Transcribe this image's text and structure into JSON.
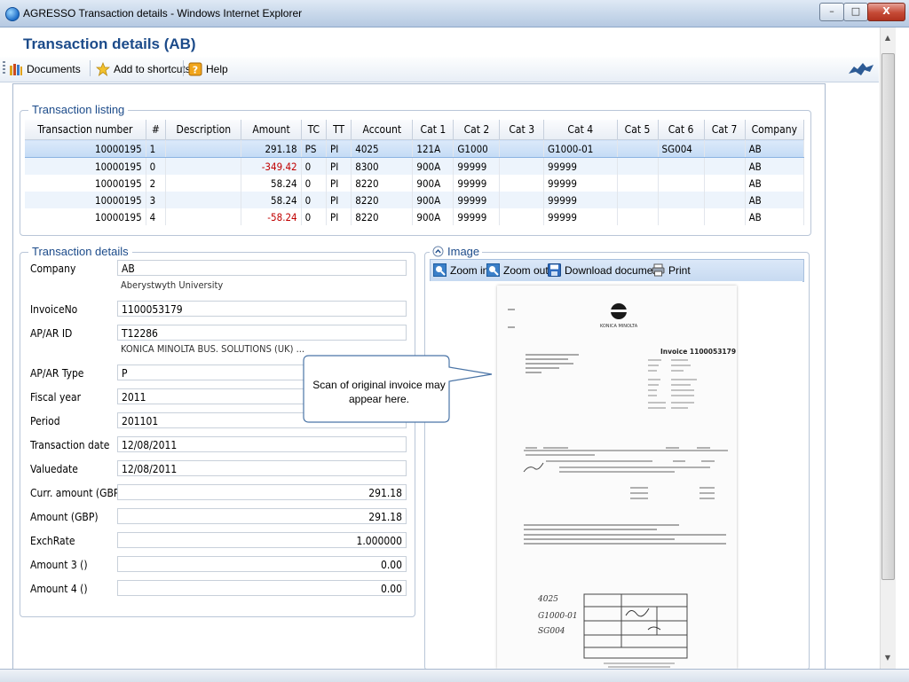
{
  "window": {
    "title": "AGRESSO Transaction details - Windows Internet Explorer",
    "min": "–",
    "max": "□",
    "close": "X"
  },
  "page": {
    "title": "Transaction details (AB)"
  },
  "toolbar": {
    "documents": "Documents",
    "shortcuts": "Add to shortcuts",
    "help": "Help"
  },
  "listing": {
    "title": "Transaction listing",
    "columns": [
      "Transaction number",
      "#",
      "Description",
      "Amount",
      "TC",
      "TT",
      "Account",
      "Cat 1",
      "Cat 2",
      "Cat 3",
      "Cat 4",
      "Cat 5",
      "Cat 6",
      "Cat 7",
      "Company"
    ],
    "rows": [
      [
        "10000195",
        "1",
        "",
        "291.18",
        "PS",
        "PI",
        "4025",
        "121A",
        "G1000",
        "",
        "G1000-01",
        "",
        "SG004",
        "",
        "AB"
      ],
      [
        "10000195",
        "0",
        "",
        "-349.42",
        "0",
        "PI",
        "8300",
        "900A",
        "99999",
        "",
        "99999",
        "",
        "",
        "",
        "AB"
      ],
      [
        "10000195",
        "2",
        "",
        "58.24",
        "0",
        "PI",
        "8220",
        "900A",
        "99999",
        "",
        "99999",
        "",
        "",
        "",
        "AB"
      ],
      [
        "10000195",
        "3",
        "",
        "58.24",
        "0",
        "PI",
        "8220",
        "900A",
        "99999",
        "",
        "99999",
        "",
        "",
        "",
        "AB"
      ],
      [
        "10000195",
        "4",
        "",
        "-58.24",
        "0",
        "PI",
        "8220",
        "900A",
        "99999",
        "",
        "99999",
        "",
        "",
        "",
        "AB"
      ]
    ]
  },
  "details": {
    "title": "Transaction details",
    "company_label": "Company",
    "company": "AB",
    "company_desc": "Aberystwyth University",
    "invoice_label": "InvoiceNo",
    "invoice": "1100053179",
    "apar_label": "AP/AR ID",
    "apar": "T12286",
    "apar_desc": "KONICA MINOLTA BUS. SOLUTIONS (UK) ...",
    "apar_type_label": "AP/AR Type",
    "apar_type": "P",
    "fiscal_label": "Fiscal year",
    "fiscal": "2011",
    "period_label": "Period",
    "period": "201101",
    "trans_date_label": "Transaction date",
    "trans_date": "12/08/2011",
    "value_date_label": "Valuedate",
    "value_date": "12/08/2011",
    "curr_amount_label": "Curr. amount (GBP)",
    "curr_amount": "291.18",
    "amount_label": "Amount (GBP)",
    "amount": "291.18",
    "exch_label": "ExchRate",
    "exch": "1.000000",
    "amount3_label": "Amount 3 ()",
    "amount3": "0.00",
    "amount4_label": "Amount 4 ()",
    "amount4": "0.00"
  },
  "image": {
    "title": "Image",
    "zoom_in": "Zoom in",
    "zoom_out": "Zoom out",
    "download": "Download document",
    "print": "Print",
    "callout": "Scan of original invoice may appear here."
  },
  "invoice_doc": {
    "brand": "KONICA MINOLTA",
    "heading": "Invoice  1100053179",
    "handwritten": [
      "4025",
      "G1000-01",
      "SG004"
    ]
  }
}
